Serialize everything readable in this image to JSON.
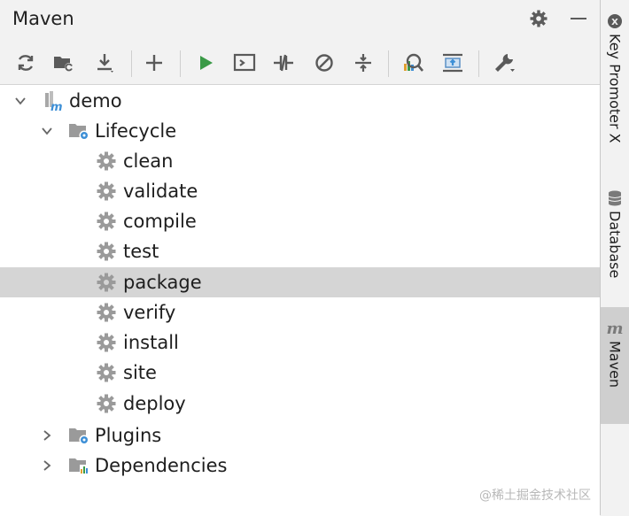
{
  "panel": {
    "title": "Maven",
    "header_icons": [
      "gear-icon",
      "minimize-icon"
    ]
  },
  "toolbar": {
    "buttons": [
      {
        "name": "reload-all-projects",
        "icon": "refresh-icon"
      },
      {
        "name": "generate-sources",
        "icon": "folder-sync-icon"
      },
      {
        "name": "download-sources",
        "icon": "download-icon"
      },
      {
        "name": "add-maven-project",
        "icon": "plus-icon"
      },
      {
        "name": "run-maven-build",
        "icon": "play-icon"
      },
      {
        "name": "execute-maven-goal",
        "icon": "terminal-icon"
      },
      {
        "name": "toggle-offline-mode",
        "icon": "offline-icon"
      },
      {
        "name": "toggle-skip-tests",
        "icon": "skip-tests-icon"
      },
      {
        "name": "show-dependencies",
        "icon": "collapse-icon"
      },
      {
        "name": "analyze-dependencies",
        "icon": "analyze-icon"
      },
      {
        "name": "expand-collapse",
        "icon": "expand-icon"
      },
      {
        "name": "maven-settings",
        "icon": "wrench-icon"
      }
    ],
    "accent_green": "#3a9a47"
  },
  "tree": {
    "root": {
      "label": "demo",
      "expanded": true,
      "icon": "maven-module-icon"
    },
    "lifecycle": {
      "label": "Lifecycle",
      "expanded": true,
      "icon": "lifecycle-folder-icon",
      "goals": [
        "clean",
        "validate",
        "compile",
        "test",
        "package",
        "verify",
        "install",
        "site",
        "deploy"
      ],
      "selected": "package"
    },
    "plugins": {
      "label": "Plugins",
      "expanded": false,
      "icon": "plugins-folder-icon"
    },
    "dependencies": {
      "label": "Dependencies",
      "expanded": false,
      "icon": "dependencies-folder-icon"
    }
  },
  "side_stripe": {
    "tabs": [
      {
        "label": "Key Promoter X",
        "icon": "key-promoter-icon",
        "active": false
      },
      {
        "label": "Database",
        "icon": "database-icon",
        "active": false
      },
      {
        "label": "Maven",
        "icon": "maven-m-icon",
        "active": true
      }
    ]
  },
  "watermark": "@稀土掘金技术社区",
  "colors": {
    "selection": "#d5d5d5",
    "icon_blue": "#3d8fd6",
    "icon_gray": "#7a7a7a"
  }
}
